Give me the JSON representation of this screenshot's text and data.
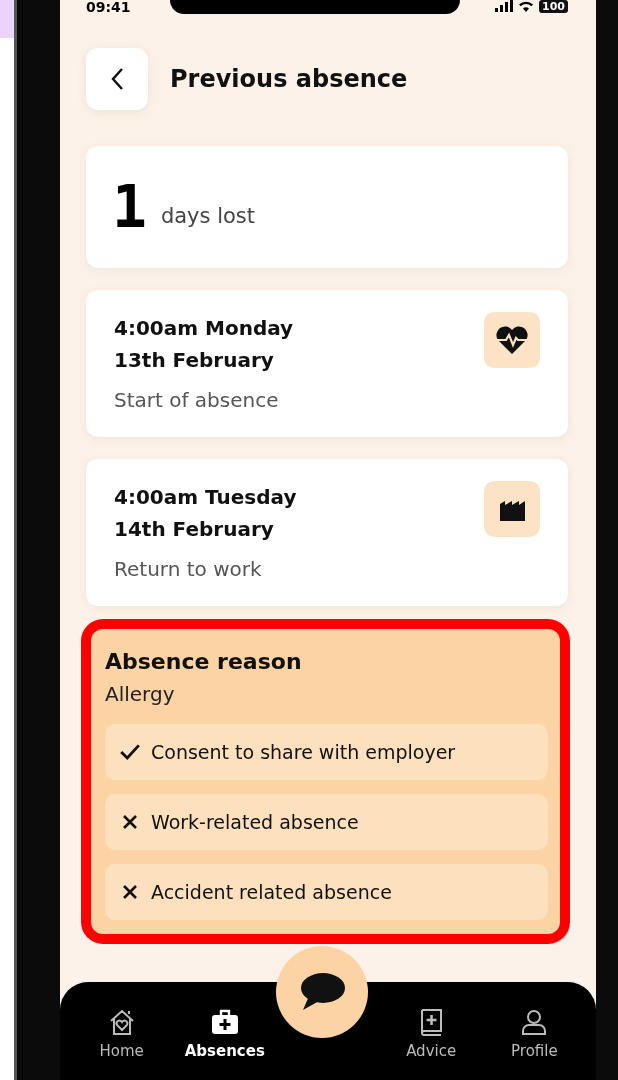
{
  "status_bar": {
    "time": "09:41",
    "battery": "100"
  },
  "header": {
    "title": "Previous absence"
  },
  "days_lost": {
    "value": "1",
    "label": "days lost"
  },
  "events": [
    {
      "time": "4:00am Monday",
      "date": "13th February",
      "label": "Start of absence",
      "kind": "heart"
    },
    {
      "time": "4:00am Tuesday",
      "date": "14th February",
      "label": "Return to work",
      "kind": "factory"
    }
  ],
  "reason": {
    "title": "Absence reason",
    "value": "Allergy",
    "highlighted": true,
    "flags": [
      {
        "label": "Consent to share with employer",
        "checked": true
      },
      {
        "label": "Work-related absence",
        "checked": false
      },
      {
        "label": "Accident related absence",
        "checked": false
      }
    ]
  },
  "nav": [
    {
      "label": "Home",
      "kind": "home",
      "selected": false
    },
    {
      "label": "Absences",
      "kind": "absences",
      "selected": true
    },
    {
      "label": "Advice",
      "kind": "advice",
      "selected": false
    },
    {
      "label": "Profile",
      "kind": "profile",
      "selected": false
    }
  ]
}
